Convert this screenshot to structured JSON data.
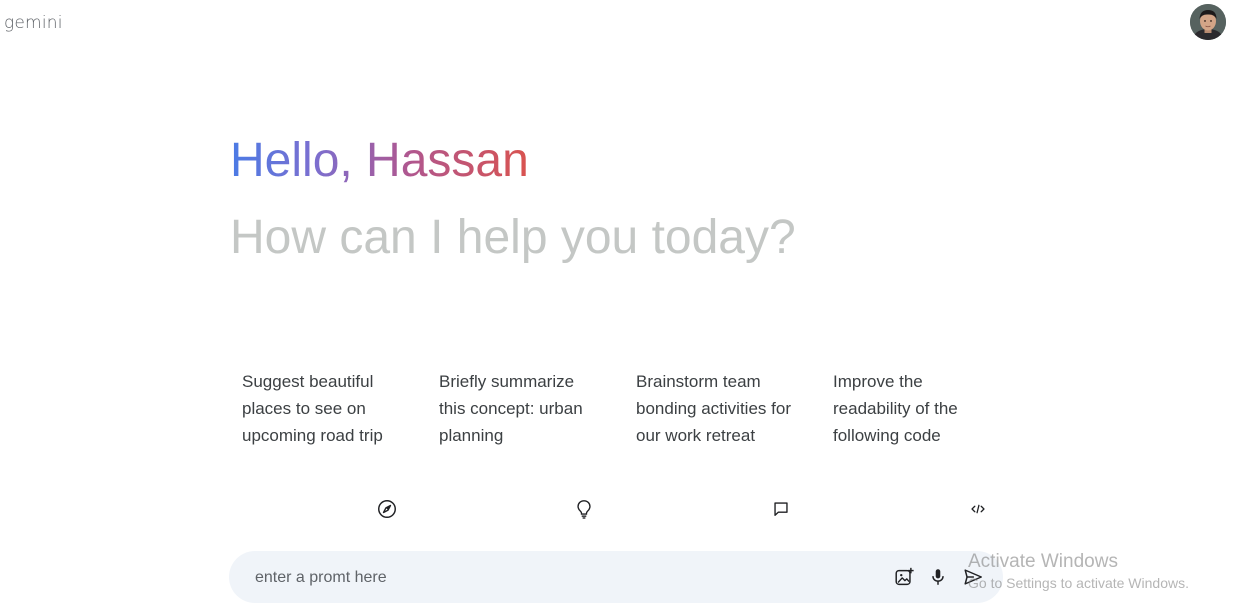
{
  "header": {
    "brand": "gemini",
    "avatar_icon": "user-avatar-photo"
  },
  "greeting": {
    "hello": "Hello, Hassan",
    "subtitle": "How can I help you today?",
    "gradient_colors": [
      "#4b7be5",
      "#b0578f",
      "#d9534f"
    ],
    "subtitle_color": "#c4c7c5"
  },
  "cards": [
    {
      "text": "Suggest beautiful places to see on upcoming road trip",
      "icon": "compass-icon"
    },
    {
      "text": "Briefly summarize this concept: urban planning",
      "icon": "lightbulb-icon"
    },
    {
      "text": "Brainstorm team bonding activities for our work retreat",
      "icon": "message-icon"
    },
    {
      "text": "Improve the readability of the following code",
      "icon": "code-icon"
    }
  ],
  "prompt": {
    "placeholder": "enter a promt here",
    "value": "",
    "buttons": [
      "image-upload-icon",
      "microphone-icon",
      "send-icon"
    ],
    "background": "#f0f4f9"
  },
  "watermark": {
    "title": "Activate Windows",
    "subtitle": "Go to Settings to activate Windows."
  }
}
